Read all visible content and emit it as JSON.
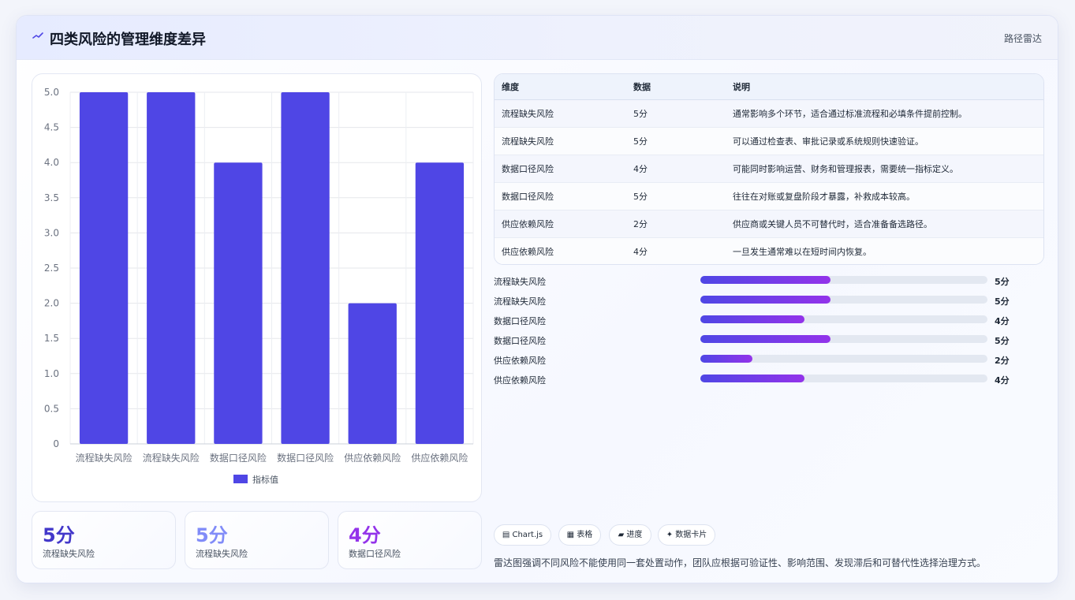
{
  "header": {
    "icon": "trend-line-icon",
    "title": "四类风险的管理维度差异",
    "right_label": "路径雷达"
  },
  "chart_data": {
    "type": "bar",
    "categories": [
      "流程缺失风险",
      "流程缺失风险",
      "数据口径风险",
      "数据口径风险",
      "供应依赖风险",
      "供应依赖风险"
    ],
    "series": [
      {
        "name": "指标值",
        "values": [
          5,
          5,
          4,
          5,
          2,
          4
        ]
      }
    ],
    "ylim": [
      0,
      5
    ],
    "yticks": [
      "0",
      "0.5",
      "1.0",
      "1.5",
      "2.0",
      "2.5",
      "3.0",
      "3.5",
      "4.0",
      "4.5",
      "5.0"
    ],
    "grid": true,
    "legend": "bottom",
    "bar_color": "#4f46e5"
  },
  "stats": [
    {
      "value": "5分",
      "label": "流程缺失风险",
      "color": "#4338ca"
    },
    {
      "value": "5分",
      "label": "流程缺失风险",
      "color": "#818cf8"
    },
    {
      "value": "4分",
      "label": "数据口径风险",
      "color": "#9333ea"
    }
  ],
  "table": {
    "headers": [
      "维度",
      "数据",
      "说明"
    ],
    "rows": [
      [
        "流程缺失风险",
        "5分",
        "通常影响多个环节，适合通过标准流程和必填条件提前控制。"
      ],
      [
        "流程缺失风险",
        "5分",
        "可以通过检查表、审批记录或系统规则快速验证。"
      ],
      [
        "数据口径风险",
        "4分",
        "可能同时影响运营、财务和管理报表，需要统一指标定义。"
      ],
      [
        "数据口径风险",
        "5分",
        "往往在对账或复盘阶段才暴露，补救成本较高。"
      ],
      [
        "供应依赖风险",
        "2分",
        "供应商或关键人员不可替代时，适合准备备选路径。"
      ],
      [
        "供应依赖风险",
        "4分",
        "一旦发生通常难以在短时间内恢复。"
      ]
    ]
  },
  "progress": [
    {
      "label": "流程缺失风险",
      "value": 5,
      "max": 11,
      "text": "5分"
    },
    {
      "label": "流程缺失风险",
      "value": 5,
      "max": 11,
      "text": "5分"
    },
    {
      "label": "数据口径风险",
      "value": 4,
      "max": 11,
      "text": "4分"
    },
    {
      "label": "数据口径风险",
      "value": 5,
      "max": 11,
      "text": "5分"
    },
    {
      "label": "供应依赖风险",
      "value": 2,
      "max": 11,
      "text": "2分"
    },
    {
      "label": "供应依赖风险",
      "value": 4,
      "max": 11,
      "text": "4分"
    }
  ],
  "chips": [
    {
      "icon": "chart-icon",
      "label": "▤ Chart.js"
    },
    {
      "icon": "table-icon",
      "label": "▦ 表格"
    },
    {
      "icon": "progress-icon",
      "label": "▰ 进度"
    },
    {
      "icon": "sparkle-icon",
      "label": "✦ 数据卡片"
    }
  ],
  "footnote": "雷达图强调不同风险不能使用同一套处置动作，团队应根据可验证性、影响范围、发现滞后和可替代性选择治理方式。"
}
